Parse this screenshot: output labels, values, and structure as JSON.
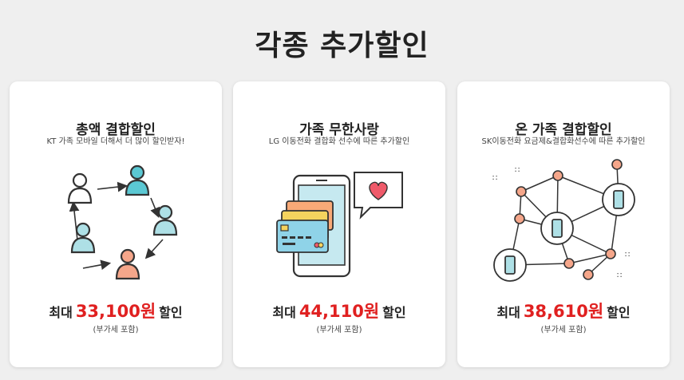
{
  "page_title": "각종 추가할인",
  "cards": [
    {
      "title": "총액 결합할인",
      "subtitle": "KT 가족 모바일 더해서 더 많이 할인받자!",
      "prefix": "최대",
      "amount": "33,100원",
      "suffix": "할인",
      "vat": "(부가세 포함)",
      "icon": "people-network-icon"
    },
    {
      "title": "가족 무한사랑",
      "subtitle": "LG 이동전화 결합화 선수에 따른 추가할인",
      "prefix": "최대",
      "amount": "44,110원",
      "suffix": "할인",
      "vat": "(부가세 포함)",
      "icon": "phone-cards-heart-icon"
    },
    {
      "title": "온 가족 결합할인",
      "subtitle": "SK이동전화 요금제&결합화선수에 따른 추가할인",
      "prefix": "최대",
      "amount": "38,610원",
      "suffix": "할인",
      "vat": "(부가세 포함)",
      "icon": "device-network-icon"
    }
  ],
  "colors": {
    "accent": "#e02020",
    "teal": "#5bc8d3",
    "light_blue": "#aee0e6",
    "salmon": "#f5a68a",
    "card_orange": "#f9a977",
    "card_yellow": "#f4d35e",
    "heart": "#ef5a6a"
  }
}
